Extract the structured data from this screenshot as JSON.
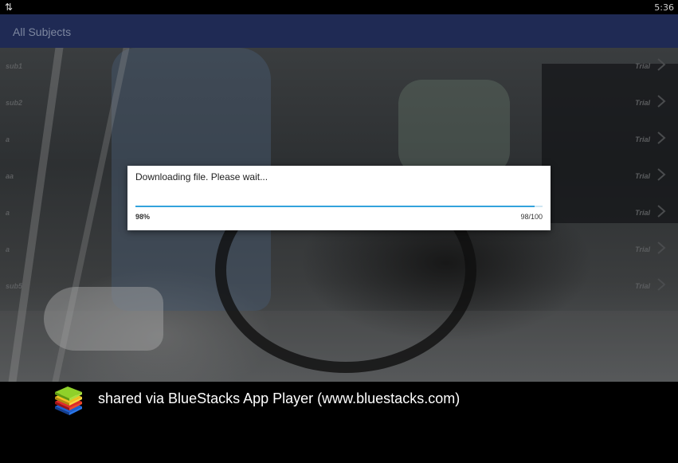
{
  "status_bar": {
    "usb_icon": "usb-icon",
    "time": "5:36"
  },
  "app": {
    "title": "All Subjects"
  },
  "subjects": [
    {
      "name": "sub1",
      "status": "Trial"
    },
    {
      "name": "sub2",
      "status": "Trial"
    },
    {
      "name": "a",
      "status": "Trial"
    },
    {
      "name": "aa",
      "status": "Trial"
    },
    {
      "name": "a",
      "status": "Trial"
    },
    {
      "name": "a",
      "status": "Trial"
    },
    {
      "name": "sub5",
      "status": "Trial"
    }
  ],
  "dialog": {
    "message": "Downloading file. Please wait...",
    "percent_label": "98%",
    "count_label": "98/100",
    "progress": 0.98
  },
  "footer": {
    "text": "shared via BlueStacks App Player (www.bluestacks.com)",
    "logo_icon": "bluestacks-logo-icon"
  },
  "colors": {
    "action_bar": "#1f2a54",
    "progress": "#33a3dc"
  }
}
